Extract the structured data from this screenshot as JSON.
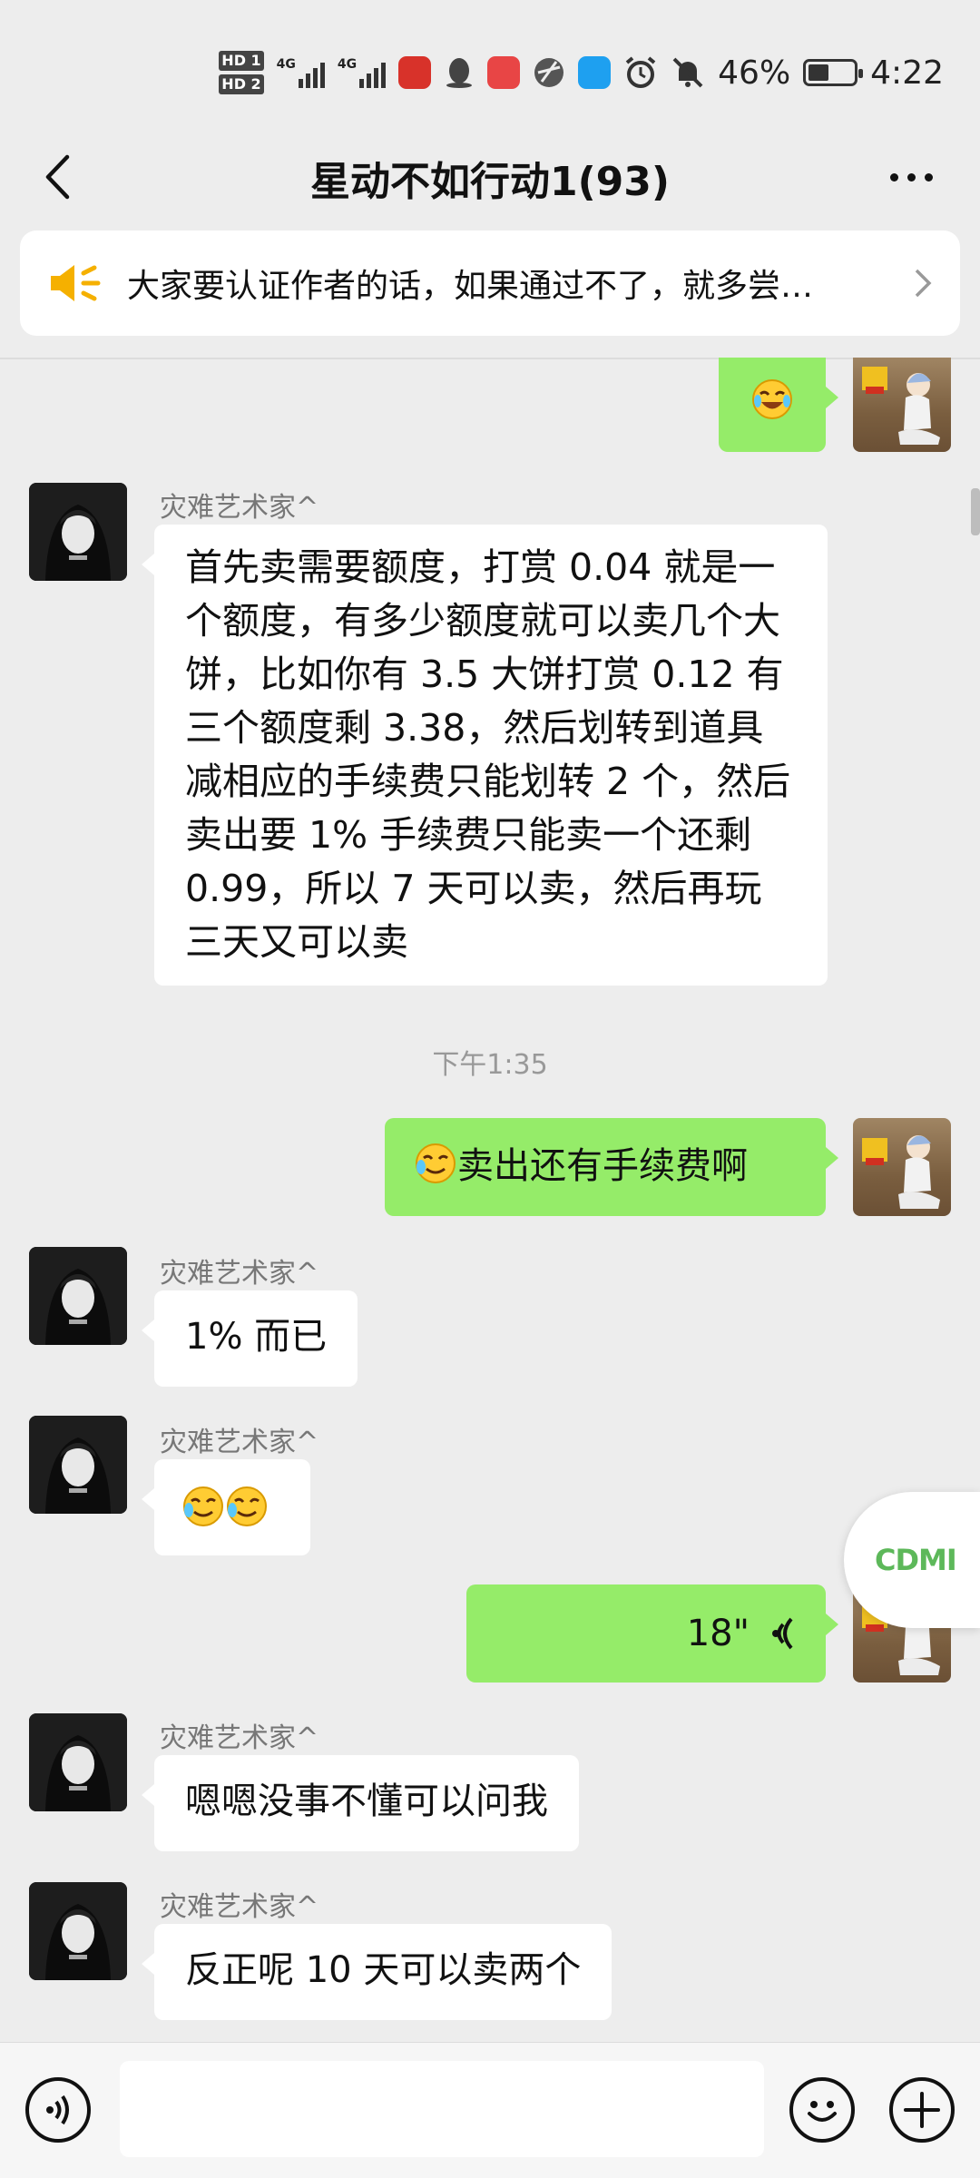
{
  "status_bar": {
    "hd1": "HD 1",
    "hd2": "HD 2",
    "signal1": "4G",
    "signal2": "4G",
    "battery": "46%",
    "time": "4:22"
  },
  "header": {
    "title": "星动不如行动1(93)"
  },
  "announcement": {
    "text": "大家要认证作者的话，如果通过不了，就多尝…"
  },
  "messages": {
    "name": "灾难艺术家^",
    "m1_text": "首先卖需要额度，打赏 0.04 就是一个额度，有多少额度就可以卖几个大饼，比如你有 3.5 大饼打赏 0.12 有三个额度剩 3.38，然后划转到道具减相应的手续费只能划转 2 个，然后卖出要 1% 手续费只能卖一个还剩 0.99，所以 7 天可以卖，然后再玩三天又可以卖",
    "timestamp": "下午1:35",
    "m2_text": "卖出还有手续费啊",
    "m3_text": "1% 而已",
    "voice_duration": "18\"",
    "m6_text": "嗯嗯没事不懂可以问我",
    "m7_text": "反正呢 10 天可以卖两个"
  },
  "floating_badge": {
    "text": "CDMI"
  },
  "colors": {
    "background": "#ededed",
    "sent_bubble": "#95ec69",
    "received_bubble": "#ffffff",
    "notice_icon": "#f5b000"
  },
  "icons": {
    "back": "chevron-left-icon",
    "more": "more-dots-icon",
    "notice": "speaker-icon",
    "voice": "voice-icon",
    "emoji": "emoji-icon",
    "add": "plus-icon"
  }
}
